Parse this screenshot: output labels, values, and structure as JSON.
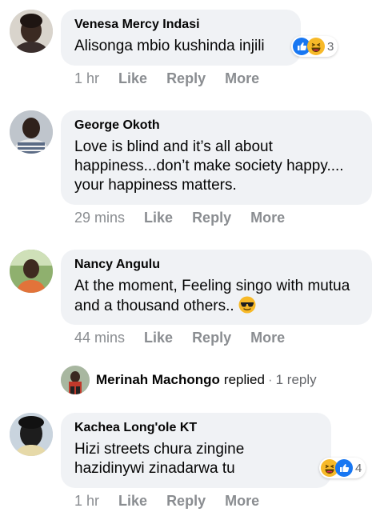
{
  "comments": [
    {
      "author": "Venesa Mercy Indasi",
      "text": "Alisonga mbio kushinda injili",
      "time": "1 hr",
      "like": "Like",
      "reply": "Reply",
      "more": "More",
      "reaction_count": "3",
      "reactions": [
        "like-icon",
        "laugh-icon"
      ]
    },
    {
      "author": "George Okoth",
      "text": "Love is blind and it’s all about happiness...don’t make society happy.... your happiness matters.",
      "time": "29 mins",
      "like": "Like",
      "reply": "Reply",
      "more": "More"
    },
    {
      "author": "Nancy Angulu",
      "text": "At the moment, Feeling singo with mutua and a thousand others..",
      "emoji": "sunglasses-emoji",
      "time": "44 mins",
      "like": "Like",
      "reply": "Reply",
      "more": "More"
    },
    {
      "author": "Kachea Long'ole KT",
      "text": "Hizi streets chura zingine hazidinywi zinadarwa tu",
      "time": "1 hr",
      "like": "Like",
      "reply": "Reply",
      "more": "More",
      "reaction_count": "4",
      "reactions": [
        "laugh-icon",
        "like-icon"
      ]
    }
  ],
  "replies_preview": {
    "name": "Merinah Machongo",
    "replied": "replied",
    "dot": "·",
    "count": "1 reply"
  },
  "colors": {
    "bubble": "#f0f2f5",
    "meta": "#8a8d91",
    "like_blue": "#1877f2",
    "laugh_yellow": "#f7b928"
  }
}
